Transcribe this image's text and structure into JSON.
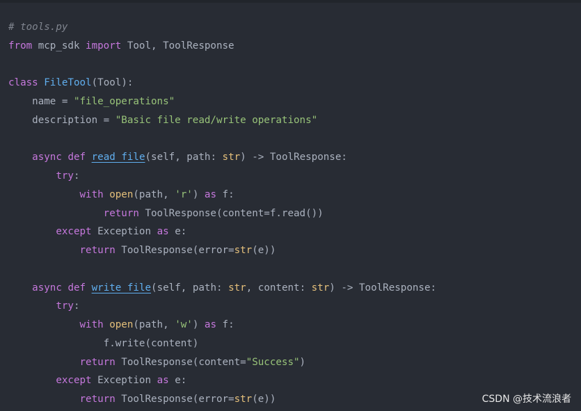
{
  "colors": {
    "background": "#282c34",
    "comment": "#7f848e",
    "keyword": "#c678dd",
    "function": "#61afef",
    "builtin": "#e5c07b",
    "string": "#98c379",
    "text": "#abb2bf"
  },
  "code": {
    "lines": [
      [
        {
          "t": "comment",
          "v": "# tools.py"
        }
      ],
      [
        {
          "t": "keyword",
          "v": "from"
        },
        {
          "t": "plain",
          "v": " mcp_sdk "
        },
        {
          "t": "keyword",
          "v": "import"
        },
        {
          "t": "plain",
          "v": " Tool, ToolResponse"
        }
      ],
      [],
      [
        {
          "t": "keyword",
          "v": "class"
        },
        {
          "t": "plain",
          "v": " "
        },
        {
          "t": "classname",
          "v": "FileTool"
        },
        {
          "t": "plain",
          "v": "(Tool):"
        }
      ],
      [
        {
          "t": "plain",
          "v": "    name = "
        },
        {
          "t": "string",
          "v": "\"file_operations\""
        }
      ],
      [
        {
          "t": "plain",
          "v": "    description = "
        },
        {
          "t": "string",
          "v": "\"Basic file read/write operations\""
        }
      ],
      [],
      [
        {
          "t": "plain",
          "v": "    "
        },
        {
          "t": "keyword",
          "v": "async"
        },
        {
          "t": "plain",
          "v": " "
        },
        {
          "t": "keyword",
          "v": "def"
        },
        {
          "t": "plain",
          "v": " "
        },
        {
          "t": "funcname",
          "v": "read_file"
        },
        {
          "t": "plain",
          "v": "(self, path: "
        },
        {
          "t": "builtin",
          "v": "str"
        },
        {
          "t": "plain",
          "v": ") -> ToolResponse:"
        }
      ],
      [
        {
          "t": "plain",
          "v": "        "
        },
        {
          "t": "keyword",
          "v": "try"
        },
        {
          "t": "plain",
          "v": ":"
        }
      ],
      [
        {
          "t": "plain",
          "v": "            "
        },
        {
          "t": "keyword",
          "v": "with"
        },
        {
          "t": "plain",
          "v": " "
        },
        {
          "t": "builtin",
          "v": "open"
        },
        {
          "t": "plain",
          "v": "(path, "
        },
        {
          "t": "string",
          "v": "'r'"
        },
        {
          "t": "plain",
          "v": ") "
        },
        {
          "t": "keyword",
          "v": "as"
        },
        {
          "t": "plain",
          "v": " f:"
        }
      ],
      [
        {
          "t": "plain",
          "v": "                "
        },
        {
          "t": "keyword",
          "v": "return"
        },
        {
          "t": "plain",
          "v": " ToolResponse(content=f.read())"
        }
      ],
      [
        {
          "t": "plain",
          "v": "        "
        },
        {
          "t": "keyword",
          "v": "except"
        },
        {
          "t": "plain",
          "v": " Exception "
        },
        {
          "t": "keyword",
          "v": "as"
        },
        {
          "t": "plain",
          "v": " e:"
        }
      ],
      [
        {
          "t": "plain",
          "v": "            "
        },
        {
          "t": "keyword",
          "v": "return"
        },
        {
          "t": "plain",
          "v": " ToolResponse(error="
        },
        {
          "t": "builtin",
          "v": "str"
        },
        {
          "t": "plain",
          "v": "(e))"
        }
      ],
      [],
      [
        {
          "t": "plain",
          "v": "    "
        },
        {
          "t": "keyword",
          "v": "async"
        },
        {
          "t": "plain",
          "v": " "
        },
        {
          "t": "keyword",
          "v": "def"
        },
        {
          "t": "plain",
          "v": " "
        },
        {
          "t": "funcname",
          "v": "write_file"
        },
        {
          "t": "plain",
          "v": "(self, path: "
        },
        {
          "t": "builtin",
          "v": "str"
        },
        {
          "t": "plain",
          "v": ", content: "
        },
        {
          "t": "builtin",
          "v": "str"
        },
        {
          "t": "plain",
          "v": ") -> ToolResponse:"
        }
      ],
      [
        {
          "t": "plain",
          "v": "        "
        },
        {
          "t": "keyword",
          "v": "try"
        },
        {
          "t": "plain",
          "v": ":"
        }
      ],
      [
        {
          "t": "plain",
          "v": "            "
        },
        {
          "t": "keyword",
          "v": "with"
        },
        {
          "t": "plain",
          "v": " "
        },
        {
          "t": "builtin",
          "v": "open"
        },
        {
          "t": "plain",
          "v": "(path, "
        },
        {
          "t": "string",
          "v": "'w'"
        },
        {
          "t": "plain",
          "v": ") "
        },
        {
          "t": "keyword",
          "v": "as"
        },
        {
          "t": "plain",
          "v": " f:"
        }
      ],
      [
        {
          "t": "plain",
          "v": "                f.write(content)"
        }
      ],
      [
        {
          "t": "plain",
          "v": "            "
        },
        {
          "t": "keyword",
          "v": "return"
        },
        {
          "t": "plain",
          "v": " ToolResponse(content="
        },
        {
          "t": "string",
          "v": "\"Success\""
        },
        {
          "t": "plain",
          "v": ")"
        }
      ],
      [
        {
          "t": "plain",
          "v": "        "
        },
        {
          "t": "keyword",
          "v": "except"
        },
        {
          "t": "plain",
          "v": " Exception "
        },
        {
          "t": "keyword",
          "v": "as"
        },
        {
          "t": "plain",
          "v": " e:"
        }
      ],
      [
        {
          "t": "plain",
          "v": "            "
        },
        {
          "t": "keyword",
          "v": "return"
        },
        {
          "t": "plain",
          "v": " ToolResponse(error="
        },
        {
          "t": "builtin",
          "v": "str"
        },
        {
          "t": "plain",
          "v": "(e))"
        }
      ]
    ]
  },
  "watermark": {
    "text": "CSDN @技术流浪者"
  }
}
